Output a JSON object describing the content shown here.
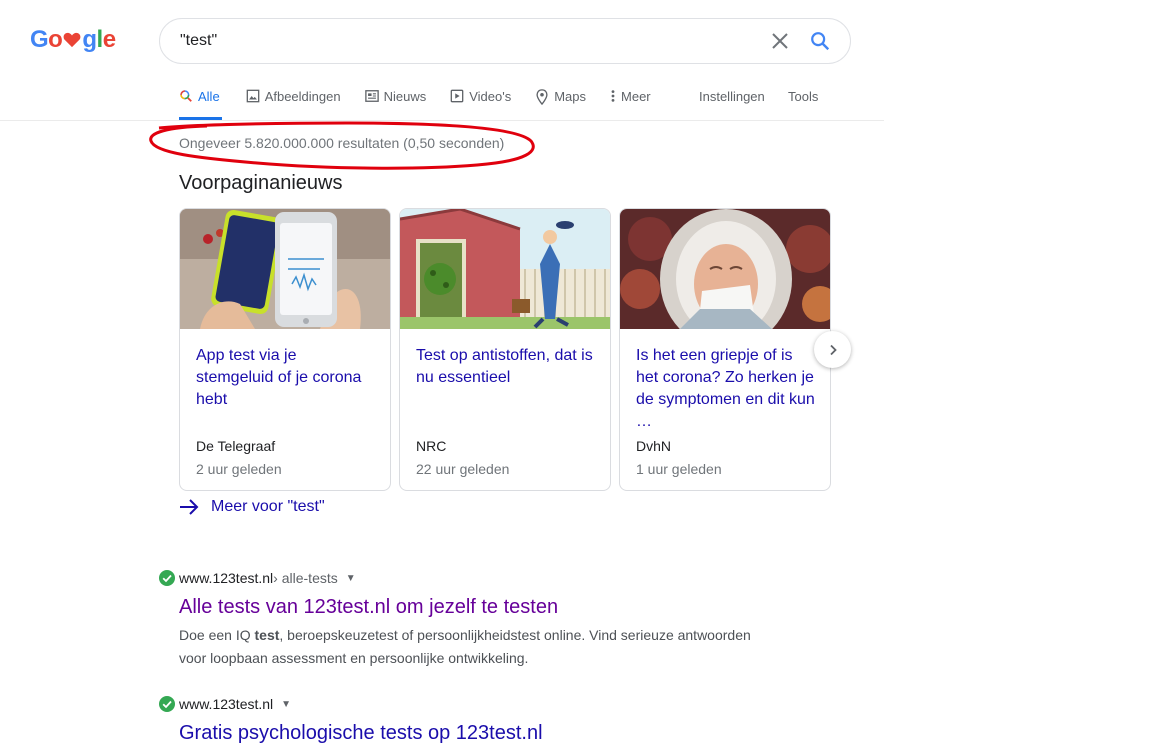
{
  "logo": {
    "letters_left": "Go",
    "letters_right": "gle"
  },
  "search": {
    "query": "\"test\""
  },
  "tabs": [
    {
      "label": "Alle",
      "icon": "search-icon"
    },
    {
      "label": "Afbeeldingen",
      "icon": "image-icon"
    },
    {
      "label": "Nieuws",
      "icon": "news-icon"
    },
    {
      "label": "Video's",
      "icon": "video-icon"
    },
    {
      "label": "Maps",
      "icon": "map-pin-icon"
    },
    {
      "label": "Meer",
      "icon": "more-vert-icon"
    }
  ],
  "tools": {
    "settings": "Instellingen",
    "tools": "Tools"
  },
  "stats": "Ongeveer 5.820.000.000 resultaten (0,50 seconden)",
  "news": {
    "heading": "Voorpaginanieuws",
    "cards": [
      {
        "headline": "App test via je stemgeluid of je corona hebt",
        "source": "De Telegraaf",
        "time": "2 uur geleden"
      },
      {
        "headline": "Test op antistoffen, dat is nu essentieel",
        "source": "NRC",
        "time": "22 uur geleden"
      },
      {
        "headline": "Is het een griepje of is het corona? Zo herken je de symptomen en dit kun …",
        "source": "DvhN",
        "time": "1 uur geleden"
      }
    ],
    "more": "Meer voor \"test\""
  },
  "results": [
    {
      "domain": "www.123test.nl",
      "path": " › alle-tests",
      "title": "Alle tests van 123test.nl om jezelf te testen",
      "snippet_pre": "Doe een IQ ",
      "snippet_bold": "test",
      "snippet_post": ", beroepskeuzetest of persoonlijkheidstest online. Vind serieuze antwoorden voor loopbaan assessment en persoonlijke ontwikkeling."
    },
    {
      "domain": "www.123test.nl",
      "path": "",
      "title": "Gratis psychologische tests op 123test.nl"
    }
  ],
  "colors": {
    "accent": "#1a73e8",
    "link": "#1a0dab",
    "visited": "#660099",
    "annotation": "#e0000d",
    "verified": "#34a853"
  }
}
